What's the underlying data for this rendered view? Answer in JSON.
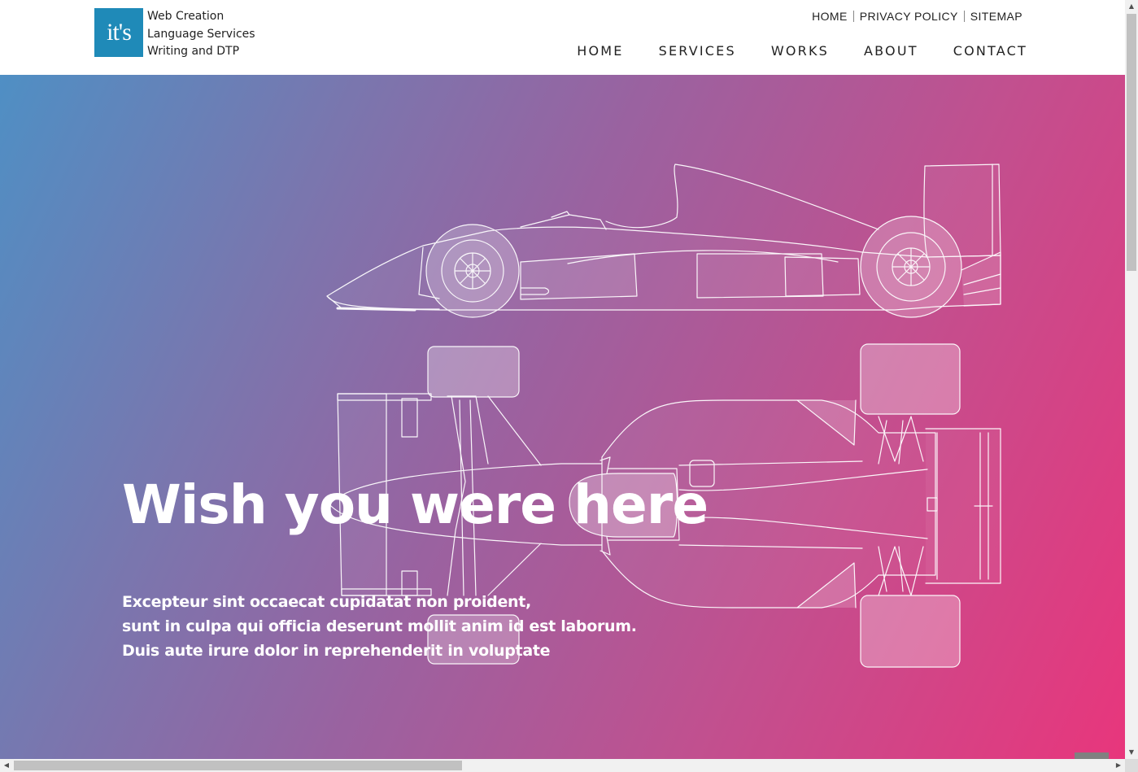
{
  "logo": {
    "mark": "it's",
    "lines": [
      "Web Creation",
      "Language Services",
      "Writing and DTP"
    ],
    "color": "#1f8ab8"
  },
  "util_nav": [
    "HOME",
    "PRIVACY POLICY",
    "SITEMAP"
  ],
  "main_nav": [
    "HOME",
    "SERVICES",
    "WORKS",
    "ABOUT",
    "CONTACT"
  ],
  "hero": {
    "title": "Wish you were here",
    "lines": [
      "Excepteur sint occaecat cupidatat non proident,",
      "sunt in culpa qui officia deserunt mollit anim id est laborum.",
      "Duis aute irure dolor in reprehenderit in voluptate"
    ],
    "gradient_start": "#4f8fc4",
    "gradient_end": "#e8367c",
    "illustration": "race-car-blueprint"
  }
}
